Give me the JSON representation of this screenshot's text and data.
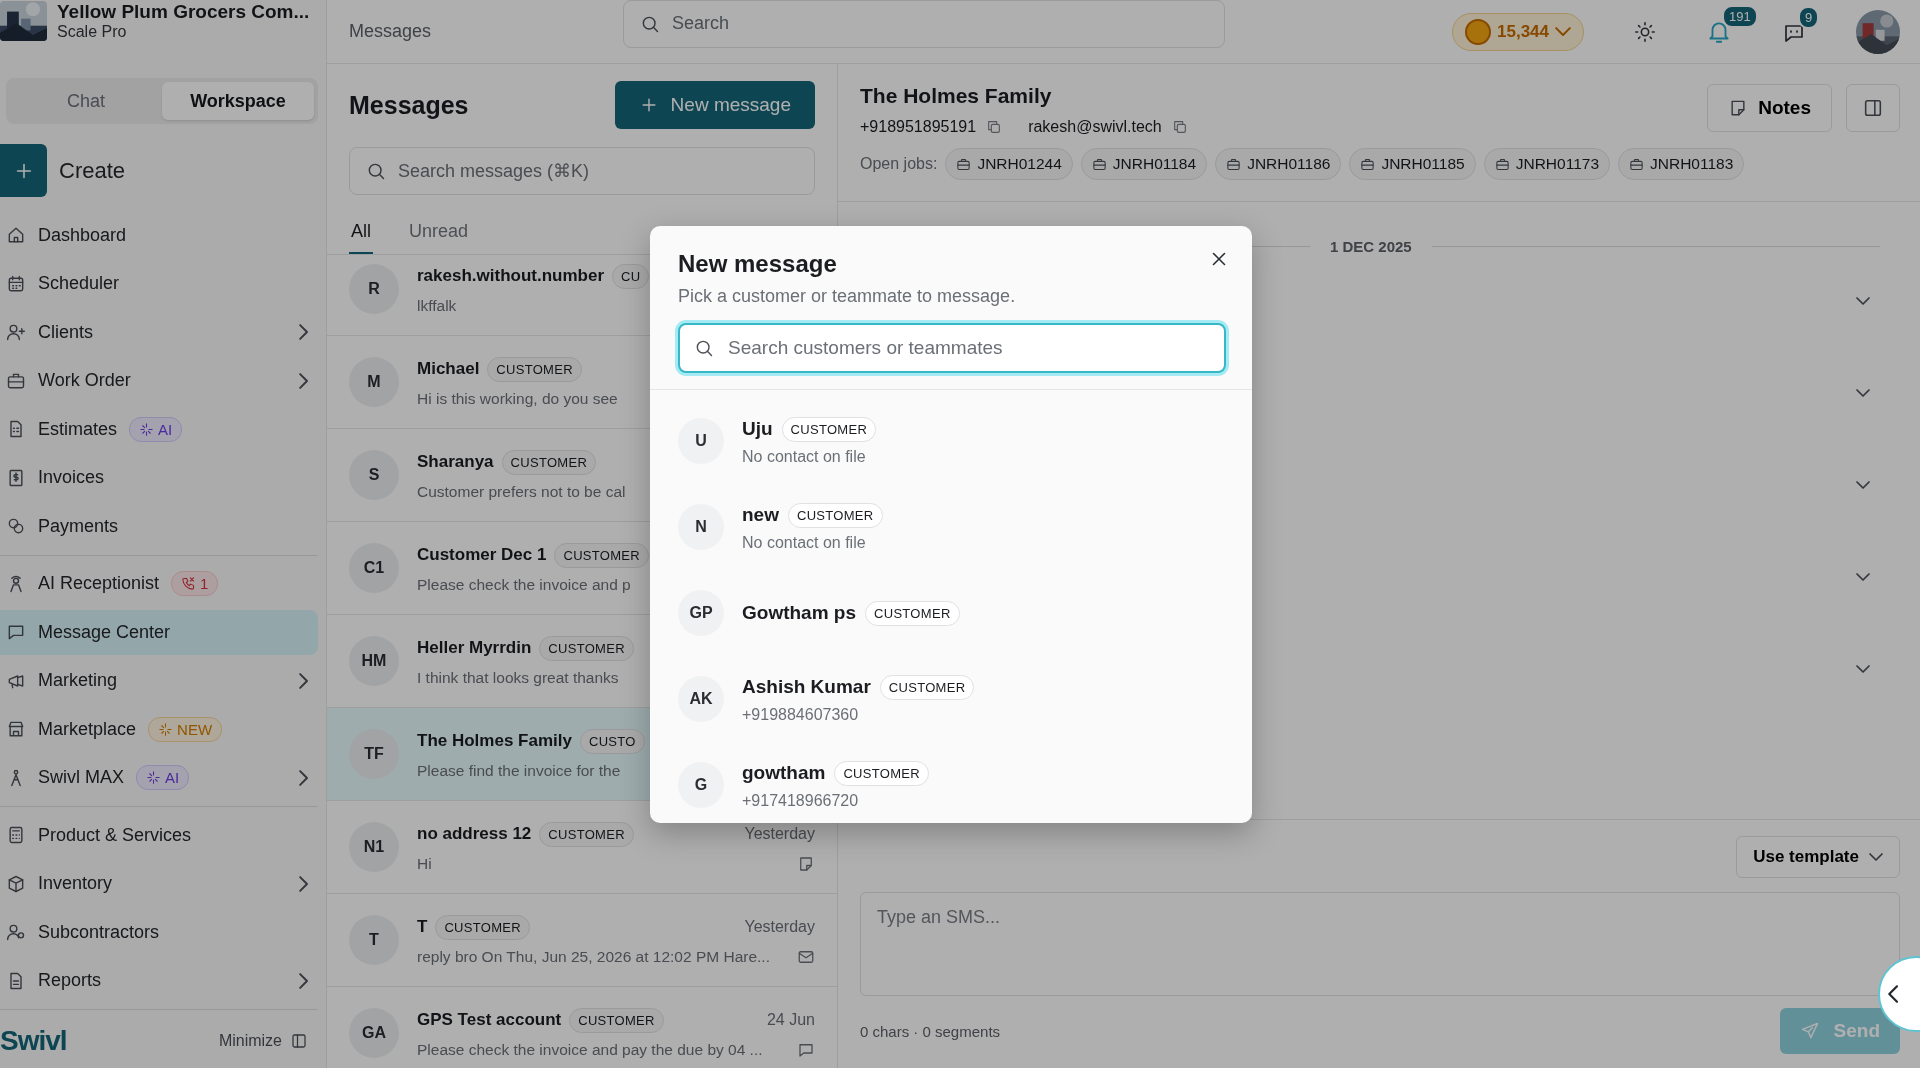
{
  "company": {
    "name": "Yellow Plum Grocers Com...",
    "plan": "Scale Pro"
  },
  "mode_tabs": [
    {
      "label": "Chat",
      "selected": false
    },
    {
      "label": "Workspace",
      "selected": true
    }
  ],
  "create_button": "Create",
  "nav_groups": [
    [
      {
        "label": "Dashboard",
        "has_submenu": false,
        "selected": false
      },
      {
        "label": "Scheduler",
        "has_submenu": false,
        "selected": false
      },
      {
        "label": "Clients",
        "has_submenu": true,
        "selected": false
      },
      {
        "label": "Work Order",
        "has_submenu": true,
        "selected": false
      },
      {
        "label": "Estimates",
        "has_submenu": false,
        "selected": false,
        "badge": {
          "text": "AI",
          "kind": "ai"
        }
      },
      {
        "label": "Invoices",
        "has_submenu": false,
        "selected": false
      },
      {
        "label": "Payments",
        "has_submenu": false,
        "selected": false
      }
    ],
    [
      {
        "label": "AI Receptionist",
        "has_submenu": false,
        "selected": false,
        "badge": {
          "text": "1",
          "kind": "calls"
        }
      },
      {
        "label": "Message Center",
        "has_submenu": false,
        "selected": true
      },
      {
        "label": "Marketing",
        "has_submenu": true,
        "selected": false
      },
      {
        "label": "Marketplace",
        "has_submenu": false,
        "selected": false,
        "badge": {
          "text": "NEW",
          "kind": "new"
        }
      },
      {
        "label": "Swivl MAX",
        "has_submenu": true,
        "selected": false,
        "badge": {
          "text": "AI",
          "kind": "ai"
        }
      }
    ],
    [
      {
        "label": "Product & Services",
        "has_submenu": false,
        "selected": false
      },
      {
        "label": "Inventory",
        "has_submenu": true,
        "selected": false
      },
      {
        "label": "Subcontractors",
        "has_submenu": false,
        "selected": false
      },
      {
        "label": "Reports",
        "has_submenu": true,
        "selected": false
      }
    ]
  ],
  "brand": "Swivl",
  "minimize": "Minimize",
  "topbar": {
    "breadcrumb": "Messages",
    "search_placeholder": "Search",
    "credits": "15,344",
    "notifications": "191",
    "chats": "9"
  },
  "messages": {
    "title": "Messages",
    "new_button": "New message",
    "search_placeholder": "Search messages (⌘K)",
    "tabs": [
      {
        "label": "All",
        "selected": true
      },
      {
        "label": "Unread",
        "selected": false
      }
    ],
    "rows": [
      {
        "initials": "R",
        "name": "rakesh.without.number",
        "tag": "CU",
        "preview": "lkffalk",
        "selected": false
      },
      {
        "initials": "M",
        "name": "Michael",
        "tag": "CUSTOMER",
        "preview": "Hi is this working, do you see",
        "selected": false
      },
      {
        "initials": "S",
        "name": "Sharanya",
        "tag": "CUSTOMER",
        "preview": "Customer prefers not to be cal",
        "selected": false
      },
      {
        "initials": "C1",
        "name": "Customer Dec 1",
        "tag": "CUSTOMER",
        "preview": "Please check the invoice and p",
        "selected": false
      },
      {
        "initials": "HM",
        "name": "Heller Myrrdin",
        "tag": "CUSTOMER",
        "preview": "I think that looks great thanks",
        "selected": false
      },
      {
        "initials": "TF",
        "name": "The Holmes Family",
        "tag": "CUSTO",
        "preview": "Please find the invoice for the",
        "selected": true
      },
      {
        "initials": "N1",
        "name": "no address 12",
        "tag": "CUSTOMER",
        "time": "Yesterday",
        "preview": "Hi",
        "kind": "note",
        "selected": false
      },
      {
        "initials": "T",
        "name": "T",
        "tag": "CUSTOMER",
        "time": "Yesterday",
        "preview": "reply bro On Thu, Jun 25, 2026 at 12:02 PM Hare...",
        "kind": "email",
        "selected": false
      },
      {
        "initials": "GA",
        "name": "GPS Test account",
        "tag": "CUSTOMER",
        "time": "24 Jun",
        "preview": "Please check the invoice and pay the due by 04 ...",
        "kind": "sms",
        "selected": false
      }
    ]
  },
  "conversation": {
    "name": "The Holmes Family",
    "phone": "+918951895191",
    "email": "rakesh@swivl.tech",
    "jobs_label": "Open jobs:",
    "jobs": [
      "JNRH01244",
      "JNRH01184",
      "JNRH01186",
      "JNRH01185",
      "JNRH01173",
      "JNRH01183"
    ],
    "notes_button": "Notes",
    "date": "1 DEC 2025",
    "template_button": "Use template",
    "sms_placeholder": "Type an SMS...",
    "counter": "0 chars · 0 segments",
    "send_button": "Send"
  },
  "modal": {
    "title": "New message",
    "subtitle": "Pick a customer or teammate to message.",
    "search_placeholder": "Search customers or teammates",
    "contacts": [
      {
        "initials": "U",
        "name": "Uju",
        "tag": "CUSTOMER",
        "detail": "No contact on file"
      },
      {
        "initials": "N",
        "name": "new",
        "tag": "CUSTOMER",
        "detail": "No contact on file"
      },
      {
        "initials": "GP",
        "name": "Gowtham ps",
        "tag": "CUSTOMER"
      },
      {
        "initials": "AK",
        "name": "Ashish Kumar",
        "tag": "CUSTOMER",
        "detail": "+919884607360"
      },
      {
        "initials": "G",
        "name": "gowtham",
        "tag": "CUSTOMER",
        "detail": "+917418966720"
      }
    ]
  }
}
